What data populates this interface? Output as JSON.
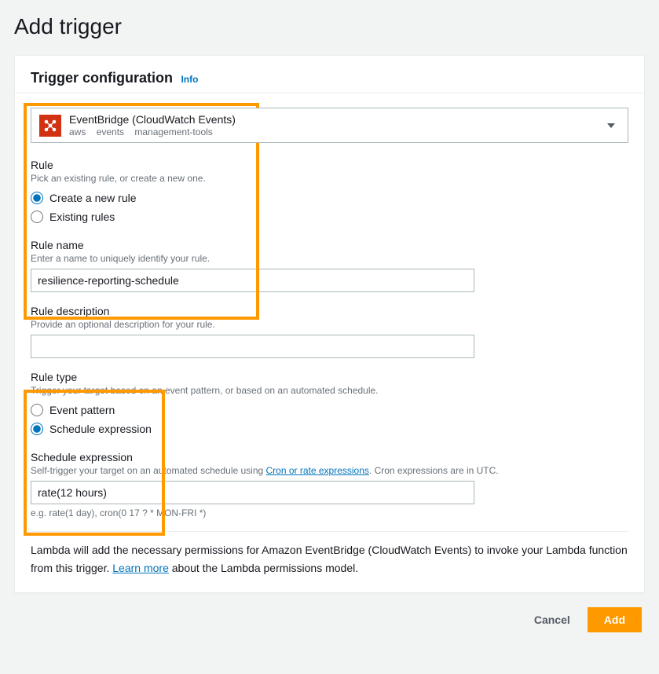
{
  "page_title": "Add trigger",
  "panel": {
    "title": "Trigger configuration",
    "info_label": "Info"
  },
  "source": {
    "name": "EventBridge (CloudWatch Events)",
    "tags": [
      "aws",
      "events",
      "management-tools"
    ]
  },
  "rule": {
    "label": "Rule",
    "help": "Pick an existing rule, or create a new one.",
    "options": {
      "create": "Create a new rule",
      "existing": "Existing rules"
    },
    "selected": "create"
  },
  "rule_name": {
    "label": "Rule name",
    "help": "Enter a name to uniquely identify your rule.",
    "value": "resilience-reporting-schedule"
  },
  "rule_description": {
    "label": "Rule description",
    "help": "Provide an optional description for your rule.",
    "value": ""
  },
  "rule_type": {
    "label": "Rule type",
    "help": "Trigger your target based on an event pattern, or based on an automated schedule.",
    "options": {
      "event_pattern": "Event pattern",
      "schedule": "Schedule expression"
    },
    "selected": "schedule"
  },
  "schedule": {
    "label": "Schedule expression",
    "help_prefix": "Self-trigger your target on an automated schedule using ",
    "help_link": "Cron or rate expressions",
    "help_suffix": ". Cron expressions are in UTC.",
    "value": "rate(12 hours)",
    "example": "e.g. rate(1 day), cron(0 17 ? * MON-FRI *)"
  },
  "permissions": {
    "text_prefix": "Lambda will add the necessary permissions for Amazon EventBridge (CloudWatch Events) to invoke your Lambda function from this trigger. ",
    "learn_more": "Learn more",
    "text_suffix": " about the Lambda permissions model."
  },
  "footer": {
    "cancel": "Cancel",
    "add": "Add"
  }
}
